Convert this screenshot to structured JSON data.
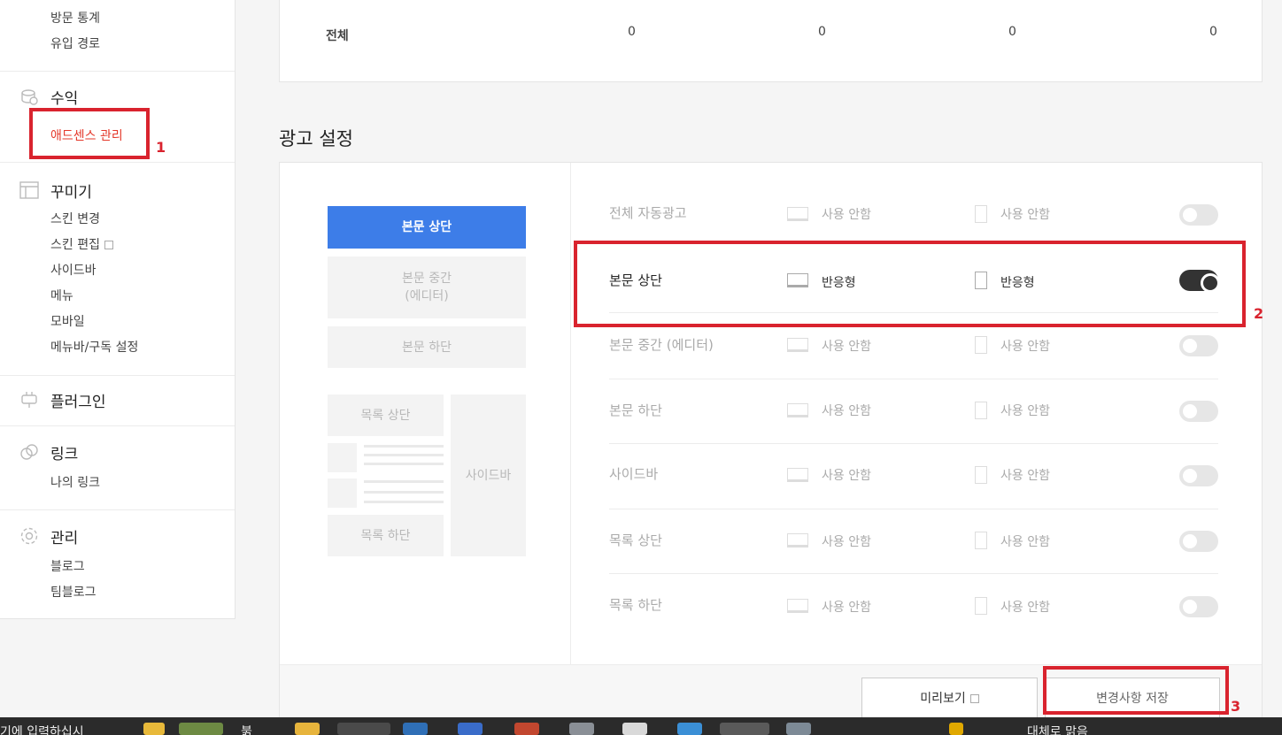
{
  "sidebar": {
    "stats_items": [
      "방문 통계",
      "유입 경로"
    ],
    "revenue": {
      "title": "수익",
      "items": [
        "애드센스 관리"
      ]
    },
    "decorate": {
      "title": "꾸미기",
      "items": [
        "스킨 변경",
        "스킨 편집",
        "사이드바",
        "메뉴",
        "모바일",
        "메뉴바/구독 설정"
      ]
    },
    "plugin": {
      "title": "플러그인"
    },
    "link": {
      "title": "링크",
      "items": [
        "나의 링크"
      ]
    },
    "manage": {
      "title": "관리",
      "items": [
        "블로그",
        "팀블로그"
      ]
    }
  },
  "stats_table": {
    "row_label": "전체",
    "values": [
      "0",
      "0",
      "0",
      "0"
    ]
  },
  "ad_settings": {
    "title": "광고 설정",
    "preview": {
      "top": "본문 상단",
      "middle_line1": "본문 중간",
      "middle_line2": "(에디터)",
      "bottom": "본문 하단",
      "list_top": "목록 상단",
      "list_bottom": "목록 하단",
      "sidebar": "사이드바"
    },
    "rows": [
      {
        "label": "전체 자동광고",
        "pc": "사용 안함",
        "mobile": "사용 안함",
        "enabled": false
      },
      {
        "label": "본문 상단",
        "pc": "반응형",
        "mobile": "반응형",
        "enabled": true
      },
      {
        "label": "본문 중간 (에디터)",
        "pc": "사용 안함",
        "mobile": "사용 안함",
        "enabled": false
      },
      {
        "label": "본문 하단",
        "pc": "사용 안함",
        "mobile": "사용 안함",
        "enabled": false
      },
      {
        "label": "사이드바",
        "pc": "사용 안함",
        "mobile": "사용 안함",
        "enabled": false
      },
      {
        "label": "목록 상단",
        "pc": "사용 안함",
        "mobile": "사용 안함",
        "enabled": false
      },
      {
        "label": "목록 하단",
        "pc": "사용 안함",
        "mobile": "사용 안함",
        "enabled": false
      }
    ],
    "preview_button": "미리보기",
    "save_button": "변경사항 저장"
  },
  "annotations": [
    "1",
    "2",
    "3"
  ],
  "taskbar": {
    "left_text": "기에 입력하십시",
    "weather_text": "붉",
    "right_text": "대체로 맑음"
  },
  "colors": {
    "accent": "#3d7de8",
    "highlight": "#d9232e",
    "active_link": "#e4392b"
  }
}
